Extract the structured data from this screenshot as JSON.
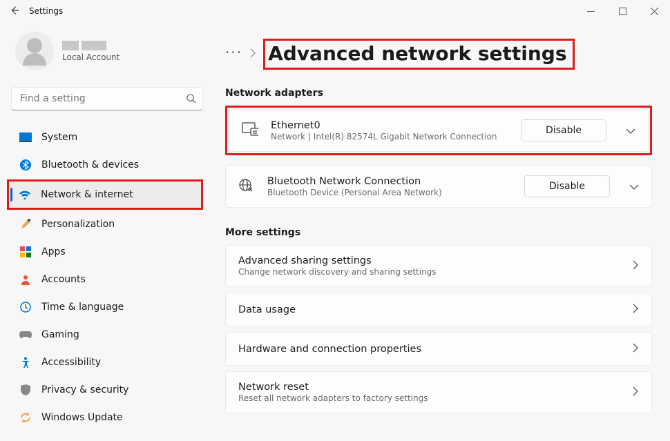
{
  "titlebar": {
    "title": "Settings"
  },
  "profile": {
    "account_type": "Local Account"
  },
  "search": {
    "placeholder": "Find a setting"
  },
  "sidebar": {
    "items": [
      {
        "label": "System"
      },
      {
        "label": "Bluetooth & devices"
      },
      {
        "label": "Network & internet"
      },
      {
        "label": "Personalization"
      },
      {
        "label": "Apps"
      },
      {
        "label": "Accounts"
      },
      {
        "label": "Time & language"
      },
      {
        "label": "Gaming"
      },
      {
        "label": "Accessibility"
      },
      {
        "label": "Privacy & security"
      },
      {
        "label": "Windows Update"
      }
    ]
  },
  "page": {
    "title": "Advanced network settings",
    "adapters_label": "Network adapters",
    "more_label": "More settings",
    "adapters": [
      {
        "name": "Ethernet0",
        "sub": "Network | Intel(R) 82574L Gigabit Network Connection",
        "button": "Disable"
      },
      {
        "name": "Bluetooth Network Connection",
        "sub": "Bluetooth Device (Personal Area Network)",
        "button": "Disable"
      }
    ],
    "settings": [
      {
        "title": "Advanced sharing settings",
        "sub": "Change network discovery and sharing settings"
      },
      {
        "title": "Data usage",
        "sub": ""
      },
      {
        "title": "Hardware and connection properties",
        "sub": ""
      },
      {
        "title": "Network reset",
        "sub": "Reset all network adapters to factory settings"
      }
    ]
  }
}
